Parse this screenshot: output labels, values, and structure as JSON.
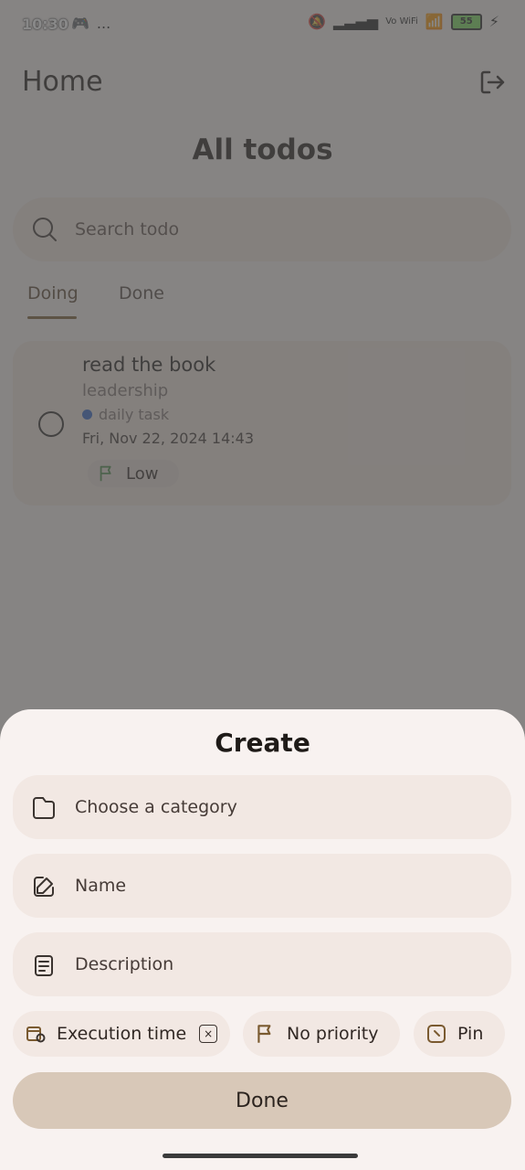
{
  "status_bar": {
    "time": "10:30",
    "dots": "...",
    "network_label": "Vo WiFi",
    "battery": "55"
  },
  "header": {
    "title": "Home"
  },
  "page": {
    "title": "All todos"
  },
  "search": {
    "placeholder": "Search todo"
  },
  "tabs": [
    {
      "label": "Doing",
      "active": true
    },
    {
      "label": "Done",
      "active": false
    }
  ],
  "todo_list": [
    {
      "title": "read the book",
      "description": "leadership",
      "category": "daily task",
      "datetime": "Fri, Nov 22, 2024 14:43",
      "priority": "Low",
      "category_color": "#2f64c8"
    }
  ],
  "sheet": {
    "title": "Create",
    "category_placeholder": "Choose a category",
    "name_placeholder": "Name",
    "description_placeholder": "Description",
    "execution_time": "Execution time",
    "priority": "No priority",
    "pin": "Pin",
    "done": "Done"
  },
  "colors": {
    "accent": "#7a5a30",
    "surface": "#f1e5de",
    "overlay": "#505050"
  }
}
